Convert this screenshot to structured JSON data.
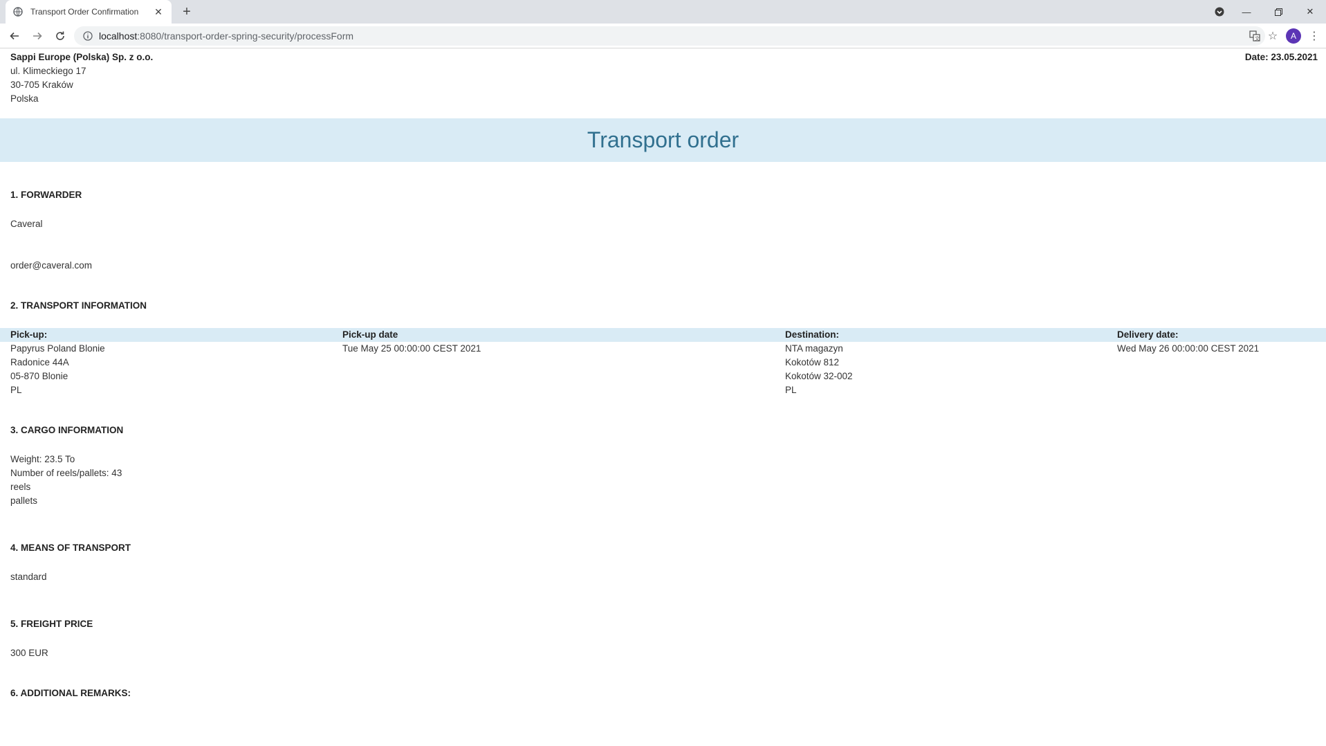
{
  "browser": {
    "tab_title": "Transport Order Confirmation",
    "url_host": "localhost",
    "url_rest": ":8080/transport-order-spring-security/processForm",
    "profile_initial": "A"
  },
  "sender": {
    "company": "Sappi Europe (Polska) Sp. z o.o.",
    "street": "ul. Klimeckiego 17",
    "city": "30-705 Kraków",
    "country": "Polska"
  },
  "date_label": "Date: 23.05.2021",
  "title": "Transport order",
  "forwarder": {
    "heading": "1. FORWARDER",
    "name": "Caveral",
    "email": "order@caveral.com"
  },
  "transport": {
    "heading": "2. TRANSPORT INFORMATION",
    "pickup_label": "Pick-up:",
    "pickup_lines": [
      "Papyrus Poland Blonie",
      "Radonice 44A",
      "05-870 Blonie",
      "PL"
    ],
    "pickup_date_label": "Pick-up date",
    "pickup_date": "Tue May 25 00:00:00 CEST 2021",
    "destination_label": "Destination:",
    "destination_lines": [
      "NTA magazyn",
      "Kokotów 812",
      "Kokotów 32-002",
      "PL"
    ],
    "delivery_date_label": "Delivery date:",
    "delivery_date": "Wed May 26 00:00:00 CEST 2021"
  },
  "cargo": {
    "heading": "3. CARGO INFORMATION",
    "weight": "Weight: 23.5 To",
    "count": "Number of reels/pallets: 43",
    "reels": "reels",
    "pallets": "pallets"
  },
  "means": {
    "heading": "4. MEANS OF TRANSPORT",
    "value": "standard"
  },
  "freight": {
    "heading": "5. FREIGHT PRICE",
    "value": "300 EUR"
  },
  "remarks": {
    "heading": "6. ADDITIONAL REMARKS:"
  },
  "icons": {
    "favicon": "globe-icon",
    "close": "close-icon",
    "new_tab": "plus-icon",
    "back": "back-arrow-icon",
    "forward": "forward-arrow-icon",
    "reload": "reload-icon",
    "info": "info-icon",
    "translate": "translate-icon",
    "bookmark": "star-icon",
    "menu": "kebab-menu-icon"
  }
}
